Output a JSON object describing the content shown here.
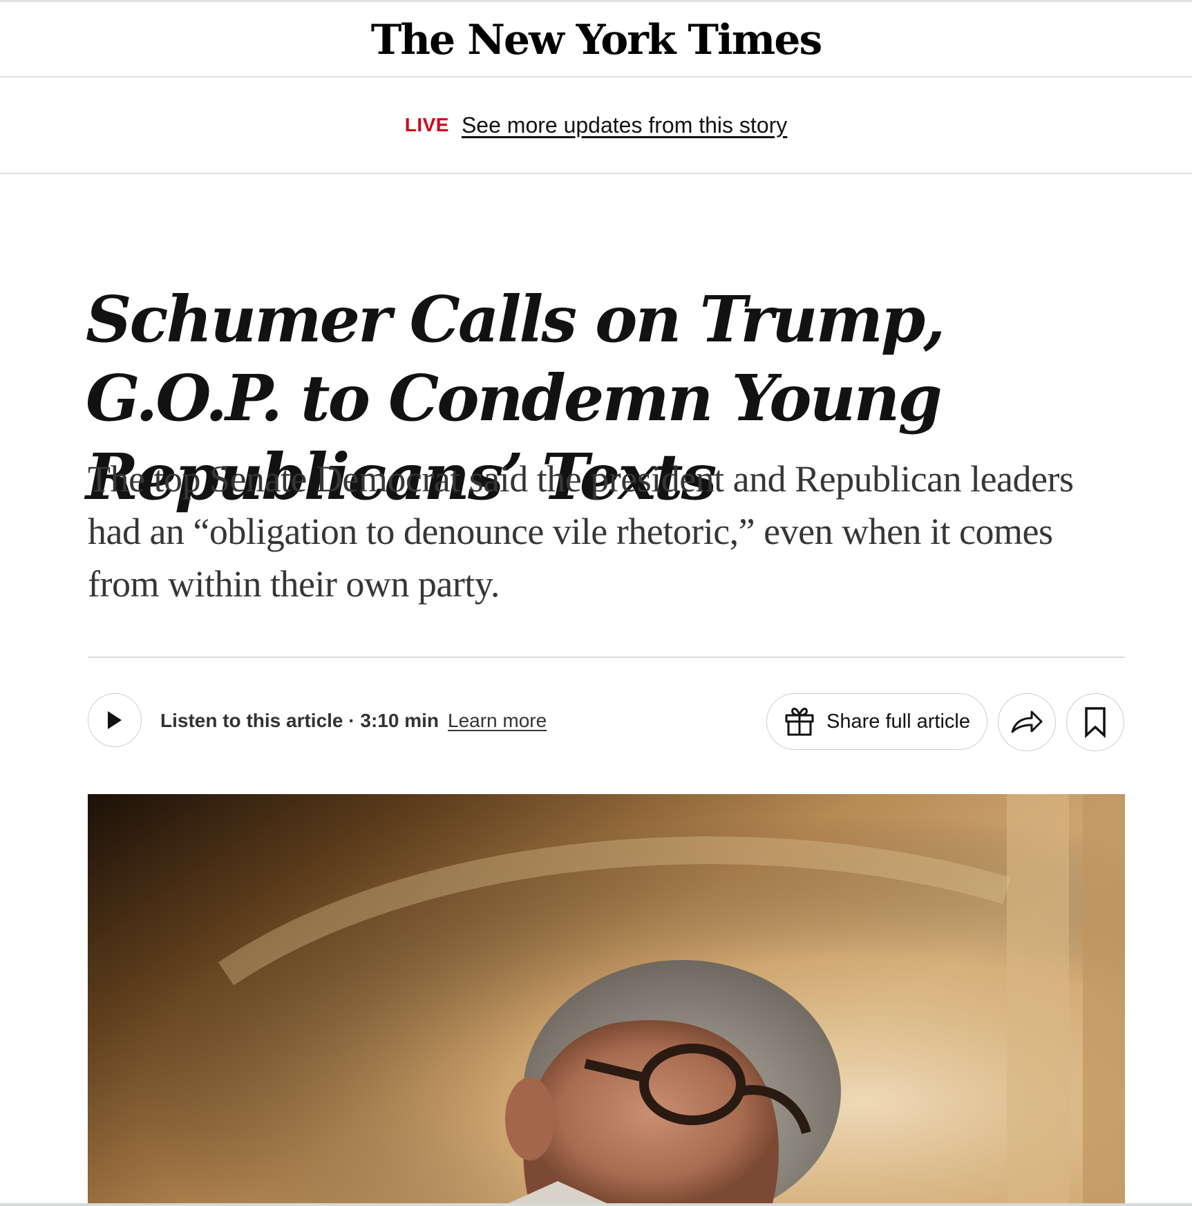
{
  "masthead": {
    "logo_text": "The New York Times"
  },
  "live_bar": {
    "label": "LIVE",
    "link_text": "See more updates from this story",
    "label_color": "#d0021b"
  },
  "article": {
    "headline": "Schumer Calls on Trump, G.O.P. to Condemn Young Republicans’ Texts",
    "summary": "The top Senate Democrat said the president and Republican leaders had an “obligation to denounce vile rhetoric,” even when it comes from within their own party."
  },
  "toolbar": {
    "listen_text": "Listen to this article · 3:10 min",
    "learn_more": "Learn more",
    "share_label": "Share full article",
    "icons": {
      "play": "play-icon",
      "gift": "gift-icon",
      "share": "share-arrow-icon",
      "bookmark": "bookmark-icon"
    }
  }
}
